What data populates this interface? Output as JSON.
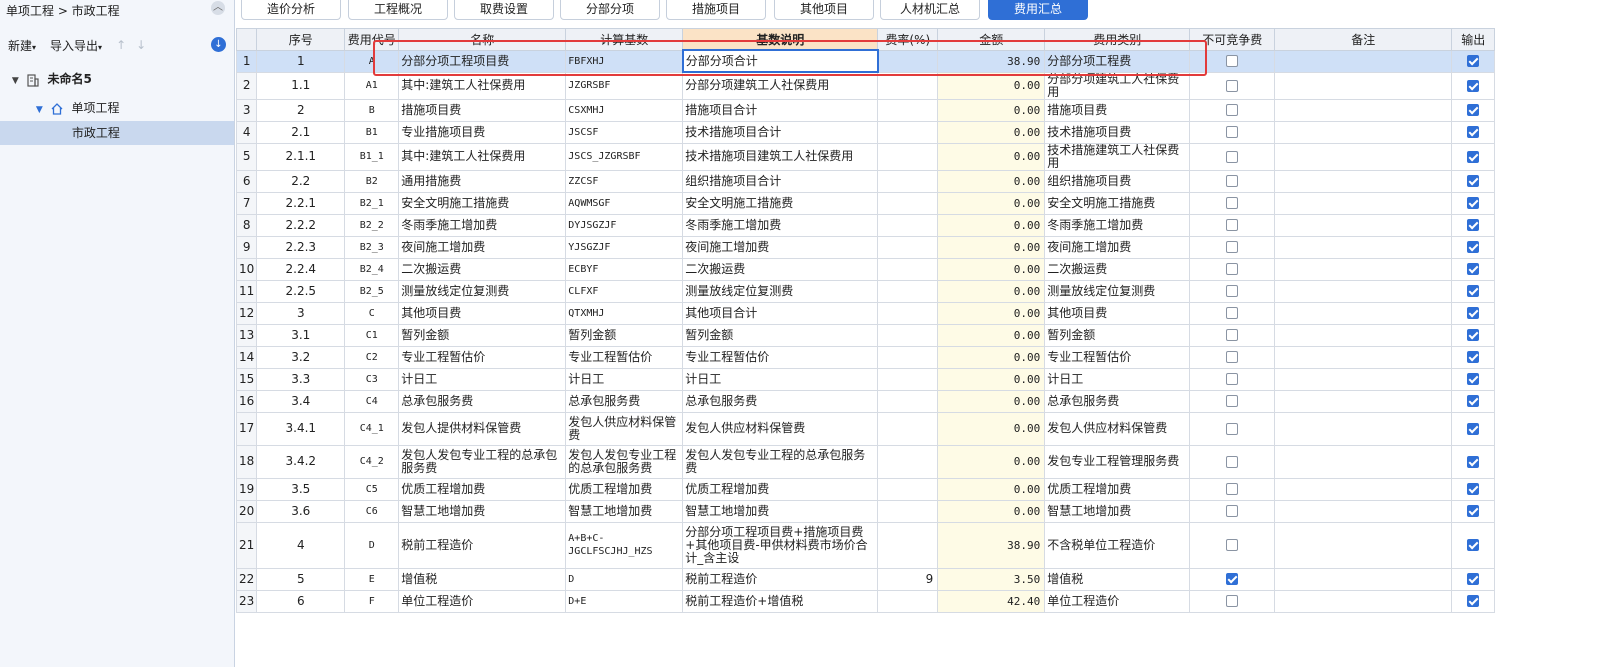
{
  "left_panel": {
    "breadcrumb": "单项工程 > 市政工程",
    "toolbar": {
      "new_label": "新建",
      "import_export_label": "导入导出",
      "up": "↑",
      "down": "↓"
    },
    "tree": {
      "root": "未命名5",
      "single": "单项工程",
      "city": "市政工程"
    }
  },
  "tabs": [
    "造价分析",
    "工程概况",
    "取费设置",
    "分部分项",
    "措施项目",
    "其他项目",
    "人材机汇总",
    "费用汇总"
  ],
  "active_tab": "费用汇总",
  "colors": {
    "accent": "#2f6fd6",
    "highlight": "#e23b3b",
    "amount_bg": "#fefbe6"
  },
  "grid": {
    "headers": [
      "",
      "序号",
      "费用代号",
      "名称",
      "计算基数",
      "基数说明",
      "费率(%)",
      "金额",
      "费用类别",
      "不可竞争费",
      "备注",
      "输出"
    ],
    "rows": [
      {
        "n": "1",
        "seq": "1",
        "code": "A",
        "name": "分部分项工程项目费",
        "base": "FBFXHJ",
        "desc": "分部分项合计",
        "rate": "",
        "amount": "38.90",
        "cat": "分部分项工程费",
        "nc": false,
        "note": "",
        "out": true
      },
      {
        "n": "2",
        "seq": "1.1",
        "code": "A1",
        "name": "其中:建筑工人社保费用",
        "base": "JZGRSBF",
        "desc": "分部分项建筑工人社保费用",
        "rate": "",
        "amount": "0.00",
        "cat": "分部分项建筑工人社保费用",
        "nc": false,
        "note": "",
        "out": true
      },
      {
        "n": "3",
        "seq": "2",
        "code": "B",
        "name": "措施项目费",
        "base": "CSXMHJ",
        "desc": "措施项目合计",
        "rate": "",
        "amount": "0.00",
        "cat": "措施项目费",
        "nc": false,
        "note": "",
        "out": true
      },
      {
        "n": "4",
        "seq": "2.1",
        "code": "B1",
        "name": "专业措施项目费",
        "base": "JSCSF",
        "desc": "技术措施项目合计",
        "rate": "",
        "amount": "0.00",
        "cat": "技术措施项目费",
        "nc": false,
        "note": "",
        "out": true
      },
      {
        "n": "5",
        "seq": "2.1.1",
        "code": "B1_1",
        "name": "其中:建筑工人社保费用",
        "base": "JSCS_JZGRSBF",
        "desc": "技术措施项目建筑工人社保费用",
        "rate": "",
        "amount": "0.00",
        "cat": "技术措施建筑工人社保费用",
        "nc": false,
        "note": "",
        "out": true
      },
      {
        "n": "6",
        "seq": "2.2",
        "code": "B2",
        "name": "通用措施费",
        "base": "ZZCSF",
        "desc": "组织措施项目合计",
        "rate": "",
        "amount": "0.00",
        "cat": "组织措施项目费",
        "nc": false,
        "note": "",
        "out": true
      },
      {
        "n": "7",
        "seq": "2.2.1",
        "code": "B2_1",
        "name": "安全文明施工措施费",
        "base": "AQWMSGF",
        "desc": "安全文明施工措施费",
        "rate": "",
        "amount": "0.00",
        "cat": "安全文明施工措施费",
        "nc": false,
        "note": "",
        "out": true
      },
      {
        "n": "8",
        "seq": "2.2.2",
        "code": "B2_2",
        "name": "冬雨季施工增加费",
        "base": "DYJSGZJF",
        "desc": "冬雨季施工增加费",
        "rate": "",
        "amount": "0.00",
        "cat": "冬雨季施工增加费",
        "nc": false,
        "note": "",
        "out": true
      },
      {
        "n": "9",
        "seq": "2.2.3",
        "code": "B2_3",
        "name": "夜间施工增加费",
        "base": "YJSGZJF",
        "desc": "夜间施工增加费",
        "rate": "",
        "amount": "0.00",
        "cat": "夜间施工增加费",
        "nc": false,
        "note": "",
        "out": true
      },
      {
        "n": "10",
        "seq": "2.2.4",
        "code": "B2_4",
        "name": "二次搬运费",
        "base": "ECBYF",
        "desc": "二次搬运费",
        "rate": "",
        "amount": "0.00",
        "cat": "二次搬运费",
        "nc": false,
        "note": "",
        "out": true
      },
      {
        "n": "11",
        "seq": "2.2.5",
        "code": "B2_5",
        "name": "测量放线定位复测费",
        "base": "CLFXF",
        "desc": "测量放线定位复测费",
        "rate": "",
        "amount": "0.00",
        "cat": "测量放线定位复测费",
        "nc": false,
        "note": "",
        "out": true
      },
      {
        "n": "12",
        "seq": "3",
        "code": "C",
        "name": "其他项目费",
        "base": "QTXMHJ",
        "desc": "其他项目合计",
        "rate": "",
        "amount": "0.00",
        "cat": "其他项目费",
        "nc": false,
        "note": "",
        "out": true
      },
      {
        "n": "13",
        "seq": "3.1",
        "code": "C1",
        "name": "暂列金额",
        "base": "暂列金额",
        "desc": "暂列金额",
        "rate": "",
        "amount": "0.00",
        "cat": "暂列金额",
        "nc": false,
        "note": "",
        "out": true
      },
      {
        "n": "14",
        "seq": "3.2",
        "code": "C2",
        "name": "专业工程暂估价",
        "base": "专业工程暂估价",
        "desc": "专业工程暂估价",
        "rate": "",
        "amount": "0.00",
        "cat": "专业工程暂估价",
        "nc": false,
        "note": "",
        "out": true
      },
      {
        "n": "15",
        "seq": "3.3",
        "code": "C3",
        "name": "计日工",
        "base": "计日工",
        "desc": "计日工",
        "rate": "",
        "amount": "0.00",
        "cat": "计日工",
        "nc": false,
        "note": "",
        "out": true
      },
      {
        "n": "16",
        "seq": "3.4",
        "code": "C4",
        "name": "总承包服务费",
        "base": "总承包服务费",
        "desc": "总承包服务费",
        "rate": "",
        "amount": "0.00",
        "cat": "总承包服务费",
        "nc": false,
        "note": "",
        "out": true
      },
      {
        "n": "17",
        "seq": "3.4.1",
        "code": "C4_1",
        "name": "发包人提供材料保管费",
        "base": "发包人供应材料保管费",
        "desc": "发包人供应材料保管费",
        "rate": "",
        "amount": "0.00",
        "cat": "发包人供应材料保管费",
        "nc": false,
        "note": "",
        "out": true
      },
      {
        "n": "18",
        "seq": "3.4.2",
        "code": "C4_2",
        "name": "发包人发包专业工程的总承包服务费",
        "base": "发包人发包专业工程的总承包服务费",
        "desc": "发包人发包专业工程的总承包服务费",
        "rate": "",
        "amount": "0.00",
        "cat": "发包专业工程管理服务费",
        "nc": false,
        "note": "",
        "out": true
      },
      {
        "n": "19",
        "seq": "3.5",
        "code": "C5",
        "name": "优质工程增加费",
        "base": "优质工程增加费",
        "desc": "优质工程增加费",
        "rate": "",
        "amount": "0.00",
        "cat": "优质工程增加费",
        "nc": false,
        "note": "",
        "out": true
      },
      {
        "n": "20",
        "seq": "3.6",
        "code": "C6",
        "name": "智慧工地增加费",
        "base": "智慧工地增加费",
        "desc": "智慧工地增加费",
        "rate": "",
        "amount": "0.00",
        "cat": "智慧工地增加费",
        "nc": false,
        "note": "",
        "out": true
      },
      {
        "n": "21",
        "seq": "4",
        "code": "D",
        "name": "税前工程造价",
        "base": "A+B+C-JGCLFSCJHJ_HZS",
        "desc": "分部分项工程项目费+措施项目费+其他项目费-甲供材料费市场价合计_含主设",
        "rate": "",
        "amount": "38.90",
        "cat": "不含税单位工程造价",
        "nc": false,
        "note": "",
        "out": true
      },
      {
        "n": "22",
        "seq": "5",
        "code": "E",
        "name": "增值税",
        "base": "D",
        "desc": "税前工程造价",
        "rate": "9",
        "amount": "3.50",
        "cat": "增值税",
        "nc": true,
        "note": "",
        "out": true
      },
      {
        "n": "23",
        "seq": "6",
        "code": "F",
        "name": "单位工程造价",
        "base": "D+E",
        "desc": "税前工程造价+增值税",
        "rate": "",
        "amount": "42.40",
        "cat": "单位工程造价",
        "nc": false,
        "note": "",
        "out": true
      }
    ]
  }
}
